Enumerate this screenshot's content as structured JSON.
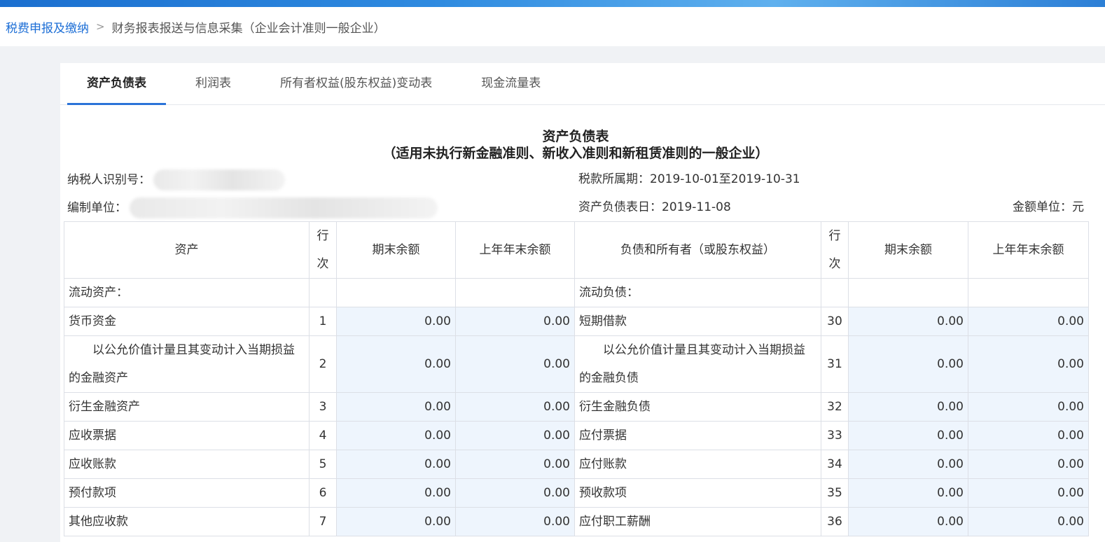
{
  "breadcrumb": {
    "home": "税费申报及缴纳",
    "separator": ">",
    "current": "财务报表报送与信息采集（企业会计准则一般企业）"
  },
  "tabs": [
    {
      "label": "资产负债表",
      "active": true
    },
    {
      "label": "利润表",
      "active": false
    },
    {
      "label": "所有者权益(股东权益)变动表",
      "active": false
    },
    {
      "label": "现金流量表",
      "active": false
    }
  ],
  "report": {
    "title": "资产负债表",
    "subtitle": "（适用未执行新金融准则、新收入准则和新租赁准则的一般企业）",
    "taxpayer_id_label": "纳税人识别号：",
    "tax_period": "税款所属期：2019-10-01至2019-10-31",
    "org_label": "编制单位：",
    "sheet_date": "资产负债表日：2019-11-08",
    "unit": "金额单位：元"
  },
  "table": {
    "headers": {
      "asset": "资产",
      "row_no_1": "行",
      "row_no_2": "次",
      "end_balance": "期末余额",
      "prev_year_end": "上年年末余额",
      "liab": "负债和所有者（或股东权益）"
    },
    "section_row": {
      "asset": "流动资产：",
      "liab": "流动负债："
    },
    "rows": [
      {
        "asset": "货币资金",
        "a_no": "1",
        "a_end": "0.00",
        "a_prev": "0.00",
        "liab": "短期借款",
        "l_no": "30",
        "l_end": "0.00",
        "l_prev": "0.00"
      },
      {
        "asset_1": "以公允价值计量且其变动计入当期损益",
        "asset_2": "的金融资产",
        "a_no": "2",
        "a_end": "0.00",
        "a_prev": "0.00",
        "liab_1": "以公允价值计量且其变动计入当期损益",
        "liab_2": "的金融负债",
        "l_no": "31",
        "l_end": "0.00",
        "l_prev": "0.00"
      },
      {
        "asset": "衍生金融资产",
        "a_no": "3",
        "a_end": "0.00",
        "a_prev": "0.00",
        "liab": "衍生金融负债",
        "l_no": "32",
        "l_end": "0.00",
        "l_prev": "0.00"
      },
      {
        "asset": "应收票据",
        "a_no": "4",
        "a_end": "0.00",
        "a_prev": "0.00",
        "liab": "应付票据",
        "l_no": "33",
        "l_end": "0.00",
        "l_prev": "0.00"
      },
      {
        "asset": "应收账款",
        "a_no": "5",
        "a_end": "0.00",
        "a_prev": "0.00",
        "liab": "应付账款",
        "l_no": "34",
        "l_end": "0.00",
        "l_prev": "0.00"
      },
      {
        "asset": "预付款项",
        "a_no": "6",
        "a_end": "0.00",
        "a_prev": "0.00",
        "liab": "预收款项",
        "l_no": "35",
        "l_end": "0.00",
        "l_prev": "0.00"
      },
      {
        "asset": "其他应收款",
        "a_no": "7",
        "a_end": "0.00",
        "a_prev": "0.00",
        "liab": "应付职工薪酬",
        "l_no": "36",
        "l_end": "0.00",
        "l_prev": "0.00"
      }
    ]
  },
  "colors": {
    "accent": "#2b73d8",
    "amount": "#1e88e5",
    "amount_bg": "#eef5fd"
  }
}
